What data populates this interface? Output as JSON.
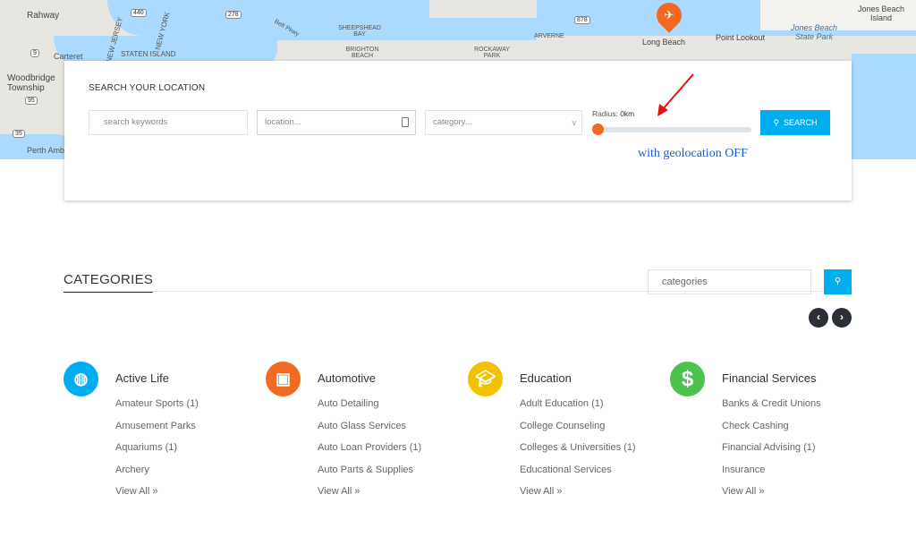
{
  "map": {
    "labels": [
      "Rahway",
      "Carteret",
      "Woodbridge Township",
      "Perth Amboy",
      "STATEN ISLAND",
      "NEW JERSEY",
      "NEW YORK",
      "Belt Pkwy",
      "SHEEPSHEAD BAY",
      "BRIGHTON BEACH",
      "ARVERNE",
      "ROCKAWAY PARK",
      "Long Beach",
      "Point Lookout",
      "Jones Beach State Park",
      "Jones Beach Island"
    ],
    "shields": [
      "440",
      "278",
      "878",
      "9",
      "35",
      "95"
    ],
    "pin_icon": "airport-pin-icon",
    "pin_color": "#f26a21"
  },
  "search": {
    "title": "SEARCH YOUR LOCATION",
    "keywords_placeholder": "search keywords",
    "location_placeholder": "location...",
    "category_placeholder": "category...",
    "radius_label": "Radius:",
    "radius_value": "0km",
    "radius_fraction": 0,
    "search_label": "SEARCH",
    "annotation": "with geolocation OFF",
    "accent": "#00aeef"
  },
  "categories": {
    "title": "CATEGORIES",
    "search_value": "categories",
    "columns": [
      {
        "name": "Active Life",
        "icon": "basketball-icon",
        "color": "#00aeef",
        "items": [
          "Amateur Sports (1)",
          "Amusement Parks",
          "Aquariums (1)",
          "Archery",
          "View All »"
        ]
      },
      {
        "name": "Automotive",
        "icon": "taxi-icon",
        "color": "#f26a21",
        "items": [
          "Auto Detailing",
          "Auto Glass Services",
          "Auto Loan Providers (1)",
          "Auto Parts & Supplies",
          "View All »"
        ]
      },
      {
        "name": "Education",
        "icon": "graduation-cap-icon",
        "color": "#f2c200",
        "items": [
          "Adult Education (1)",
          "College Counseling",
          "Colleges & Universities (1)",
          "Educational Services",
          "View All »"
        ]
      },
      {
        "name": "Financial Services",
        "icon": "dollar-icon",
        "color": "#4cc34e",
        "items": [
          "Banks & Credit Unions",
          "Check Cashing",
          "Financial Advising (1)",
          "Insurance",
          "View All »"
        ]
      }
    ]
  }
}
